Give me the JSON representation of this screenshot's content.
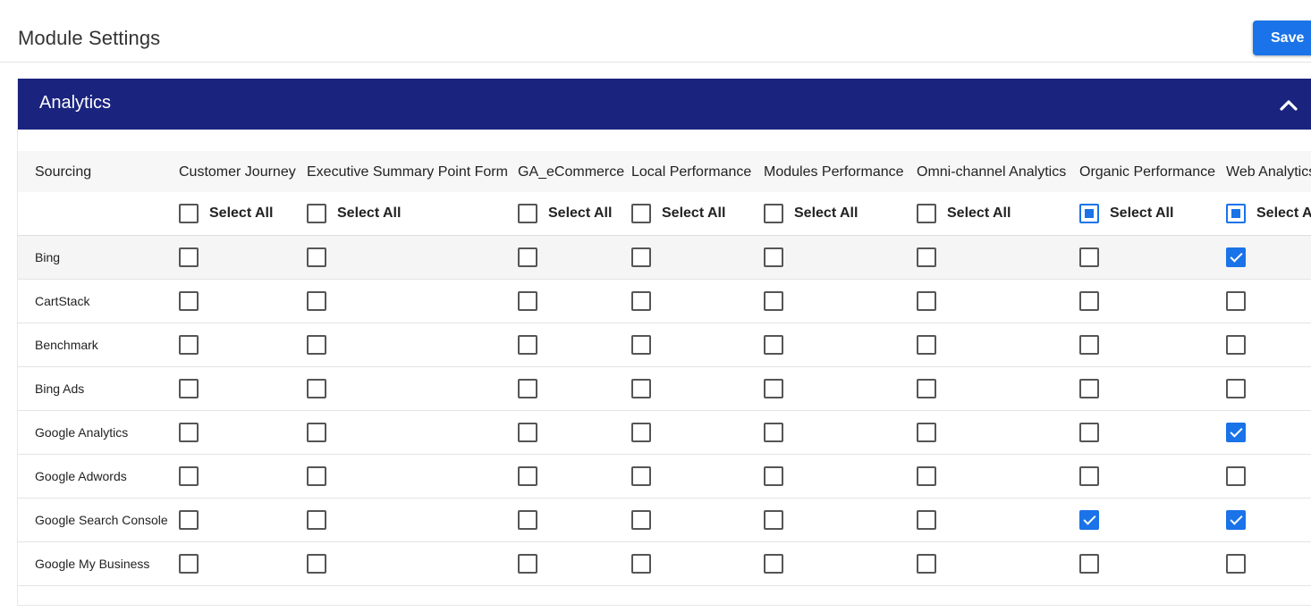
{
  "page": {
    "title": "Module Settings",
    "save_label": "Save"
  },
  "panel": {
    "title": "Analytics",
    "collapse_icon": "chevron-up-icon"
  },
  "table": {
    "first_column_header": "Sourcing",
    "select_all_label": "Select All",
    "columns": [
      "Customer Journey",
      "Executive Summary Point Form",
      "GA_eCommerce",
      "Local Performance",
      "Modules Performance",
      "Omni-channel Analytics",
      "Organic Performance",
      "Web Analytics"
    ],
    "select_all_states": [
      "unchecked",
      "unchecked",
      "unchecked",
      "unchecked",
      "unchecked",
      "unchecked",
      "indeterminate",
      "indeterminate"
    ],
    "rows": [
      {
        "source": "Bing",
        "checked": [
          false,
          false,
          false,
          false,
          false,
          false,
          false,
          true
        ]
      },
      {
        "source": "CartStack",
        "checked": [
          false,
          false,
          false,
          false,
          false,
          false,
          false,
          false
        ]
      },
      {
        "source": "Benchmark",
        "checked": [
          false,
          false,
          false,
          false,
          false,
          false,
          false,
          false
        ]
      },
      {
        "source": "Bing Ads",
        "checked": [
          false,
          false,
          false,
          false,
          false,
          false,
          false,
          false
        ]
      },
      {
        "source": "Google Analytics",
        "checked": [
          false,
          false,
          false,
          false,
          false,
          false,
          false,
          true
        ]
      },
      {
        "source": "Google Adwords",
        "checked": [
          false,
          false,
          false,
          false,
          false,
          false,
          false,
          false
        ]
      },
      {
        "source": "Google Search Console",
        "checked": [
          false,
          false,
          false,
          false,
          false,
          false,
          true,
          true
        ]
      },
      {
        "source": "Google My Business",
        "checked": [
          false,
          false,
          false,
          false,
          false,
          false,
          false,
          false
        ]
      }
    ],
    "highlight_row_color": "#f5f5f5"
  },
  "colors": {
    "accent": "#1a73e8",
    "header_bar": "#1a237e"
  }
}
